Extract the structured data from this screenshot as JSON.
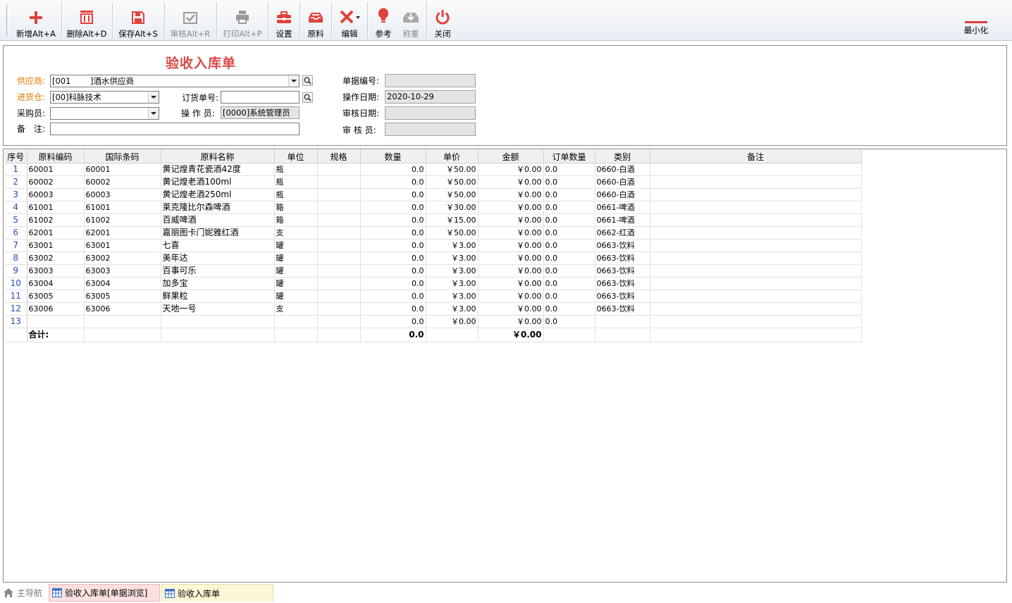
{
  "toolbar": {
    "buttons": [
      {
        "id": "add",
        "label": "新增Alt+A",
        "icon": "plus-icon",
        "enabled": true
      },
      {
        "id": "delete",
        "label": "删除Alt+D",
        "icon": "trash-icon",
        "enabled": true
      },
      {
        "id": "save",
        "label": "保存Alt+S",
        "icon": "save-icon",
        "enabled": true
      },
      {
        "id": "audit",
        "label": "审核Alt+R",
        "icon": "check-icon",
        "enabled": false
      },
      {
        "id": "print",
        "label": "打印Alt+P",
        "icon": "printer-icon",
        "enabled": false
      },
      {
        "id": "settings",
        "label": "设置",
        "icon": "toolbox-icon",
        "enabled": true
      },
      {
        "id": "material",
        "label": "原料",
        "icon": "tray-icon",
        "enabled": true
      },
      {
        "id": "edit",
        "label": "编辑",
        "icon": "edit-tools-icon",
        "enabled": true
      },
      {
        "id": "reference",
        "label": "参考",
        "icon": "lightbulb-icon",
        "enabled": true
      },
      {
        "id": "weigh",
        "label": "称重",
        "icon": "scale-icon",
        "enabled": false
      },
      {
        "id": "close",
        "label": "关闭",
        "icon": "power-icon",
        "enabled": true
      }
    ],
    "minimize_label": "最小化"
  },
  "form": {
    "title": "验收入库单",
    "supplier_label": "供应商:",
    "supplier_code": "[001",
    "supplier_name": "]酒水供应商",
    "warehouse_label": "进货仓:",
    "warehouse_value": "[00]科脉技术",
    "buyer_label": "采购员:",
    "buyer_value": "",
    "remark_label": "备　注:",
    "remark_value": "",
    "order_no_label": "订货单号:",
    "order_no_value": "",
    "operator_label": "操 作 员:",
    "operator_value": "[0000]系统管理员",
    "doc_no_label": "单据编号:",
    "doc_no_value": "",
    "op_date_label": "操作日期:",
    "op_date_value": "2020-10-29",
    "audit_date_label": "审核日期:",
    "audit_date_value": "",
    "auditor_label": "审 核 员:",
    "auditor_value": ""
  },
  "grid": {
    "columns": [
      "序号",
      "原料编码",
      "国际条码",
      "原料名称",
      "单位",
      "规格",
      "数量",
      "单价",
      "金额",
      "订单数量",
      "类别",
      "备注"
    ],
    "rows": [
      {
        "idx": "1",
        "code": "60001",
        "barcode": "60001",
        "name": "黄记煌青花瓷酒42度",
        "unit": "瓶",
        "spec": "",
        "qty": "0.0",
        "price": "￥50.00",
        "amount": "￥0.00",
        "order_qty": "0.0",
        "category": "0660-白酒",
        "remark": ""
      },
      {
        "idx": "2",
        "code": "60002",
        "barcode": "60002",
        "name": "黄记煌老酒100ml",
        "unit": "瓶",
        "spec": "",
        "qty": "0.0",
        "price": "￥50.00",
        "amount": "￥0.00",
        "order_qty": "0.0",
        "category": "0660-白酒",
        "remark": ""
      },
      {
        "idx": "3",
        "code": "60003",
        "barcode": "60003",
        "name": "黄记煌老酒250ml",
        "unit": "瓶",
        "spec": "",
        "qty": "0.0",
        "price": "￥50.00",
        "amount": "￥0.00",
        "order_qty": "0.0",
        "category": "0660-白酒",
        "remark": ""
      },
      {
        "idx": "4",
        "code": "61001",
        "barcode": "61001",
        "name": "莱克隆比尔森啤酒",
        "unit": "箱",
        "spec": "",
        "qty": "0.0",
        "price": "￥30.00",
        "amount": "￥0.00",
        "order_qty": "0.0",
        "category": "0661-啤酒",
        "remark": ""
      },
      {
        "idx": "5",
        "code": "61002",
        "barcode": "61002",
        "name": "百威啤酒",
        "unit": "箱",
        "spec": "",
        "qty": "0.0",
        "price": "￥15.00",
        "amount": "￥0.00",
        "order_qty": "0.0",
        "category": "0661-啤酒",
        "remark": ""
      },
      {
        "idx": "6",
        "code": "62001",
        "barcode": "62001",
        "name": "嘉丽图卡门妮雅红酒",
        "unit": "支",
        "spec": "",
        "qty": "0.0",
        "price": "￥50.00",
        "amount": "￥0.00",
        "order_qty": "0.0",
        "category": "0662-红酒",
        "remark": ""
      },
      {
        "idx": "7",
        "code": "63001",
        "barcode": "63001",
        "name": "七喜",
        "unit": "罐",
        "spec": "",
        "qty": "0.0",
        "price": "￥3.00",
        "amount": "￥0.00",
        "order_qty": "0.0",
        "category": "0663-饮料",
        "remark": ""
      },
      {
        "idx": "8",
        "code": "63002",
        "barcode": "63002",
        "name": "美年达",
        "unit": "罐",
        "spec": "",
        "qty": "0.0",
        "price": "￥3.00",
        "amount": "￥0.00",
        "order_qty": "0.0",
        "category": "0663-饮料",
        "remark": ""
      },
      {
        "idx": "9",
        "code": "63003",
        "barcode": "63003",
        "name": "百事可乐",
        "unit": "罐",
        "spec": "",
        "qty": "0.0",
        "price": "￥3.00",
        "amount": "￥0.00",
        "order_qty": "0.0",
        "category": "0663-饮料",
        "remark": ""
      },
      {
        "idx": "10",
        "code": "63004",
        "barcode": "63004",
        "name": "加多宝",
        "unit": "罐",
        "spec": "",
        "qty": "0.0",
        "price": "￥3.00",
        "amount": "￥0.00",
        "order_qty": "0.0",
        "category": "0663-饮料",
        "remark": ""
      },
      {
        "idx": "11",
        "code": "63005",
        "barcode": "63005",
        "name": "鲜果粒",
        "unit": "罐",
        "spec": "",
        "qty": "0.0",
        "price": "￥3.00",
        "amount": "￥0.00",
        "order_qty": "0.0",
        "category": "0663-饮料",
        "remark": ""
      },
      {
        "idx": "12",
        "code": "63006",
        "barcode": "63006",
        "name": "天地一号",
        "unit": "支",
        "spec": "",
        "qty": "0.0",
        "price": "￥3.00",
        "amount": "￥0.00",
        "order_qty": "0.0",
        "category": "0663-饮料",
        "remark": ""
      },
      {
        "idx": "13",
        "code": "",
        "barcode": "",
        "name": "",
        "unit": "",
        "spec": "",
        "qty": "0.0",
        "price": "￥0.00",
        "amount": "￥0.00",
        "order_qty": "0.0",
        "category": "",
        "remark": ""
      }
    ],
    "total": {
      "label": "合计:",
      "qty": "0.0",
      "amount": "￥0.00"
    }
  },
  "tabs": [
    {
      "label": "主导航",
      "icon": "home-icon",
      "active": false
    },
    {
      "label": "验收入库单[单据浏览]",
      "icon": "grid-icon",
      "active": false
    },
    {
      "label": "验收入库单",
      "icon": "grid-icon",
      "active": true
    }
  ],
  "colors": {
    "accent_red": "#d94a45",
    "label_orange": "#e07b00",
    "index_blue": "#1f50b0",
    "tab_pink": "#fde1e1",
    "tab_cream": "#fdf7d6"
  }
}
